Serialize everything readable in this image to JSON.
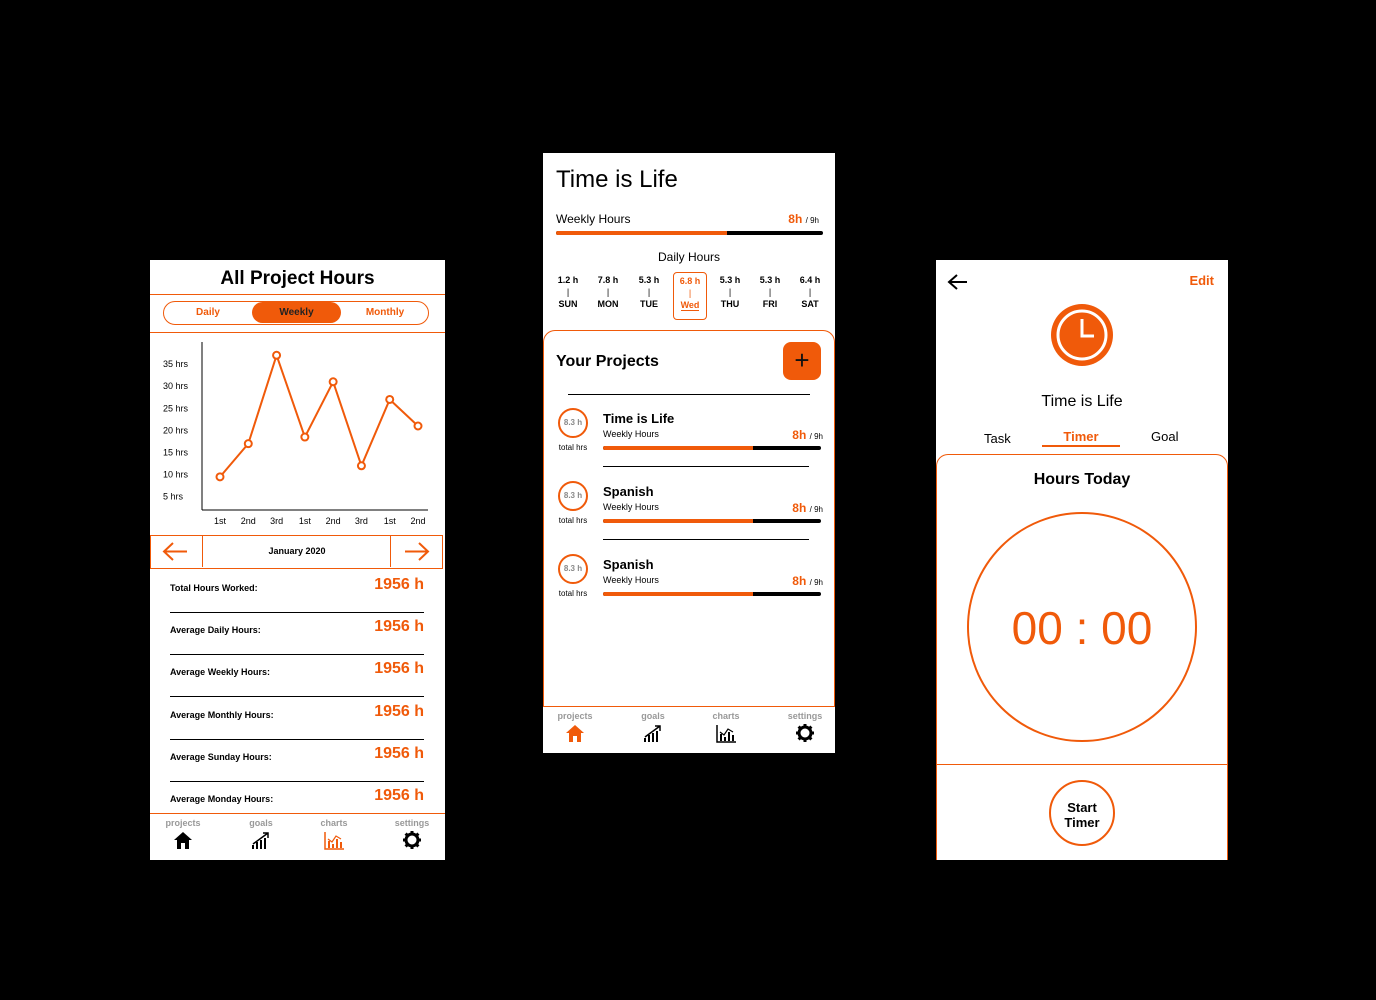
{
  "left": {
    "title": "All Project Hours",
    "tabs": [
      "Daily",
      "Weekly",
      "Monthly"
    ],
    "active_tab": "Weekly",
    "period": "January 2020",
    "stats": [
      {
        "label": "Total Hours Worked:",
        "value": "1956 h"
      },
      {
        "label": "Average Daily Hours:",
        "value": "1956 h"
      },
      {
        "label": "Average Weekly Hours:",
        "value": "1956 h"
      },
      {
        "label": "Average Monthly Hours:",
        "value": "1956 h"
      },
      {
        "label": "Average Sunday Hours:",
        "value": "1956 h"
      },
      {
        "label": "Average Monday Hours:",
        "value": "1956 h"
      }
    ]
  },
  "chart_data": {
    "type": "line",
    "categories": [
      "1st",
      "2nd",
      "3rd",
      "1st",
      "2nd",
      "3rd",
      "1st",
      "2nd"
    ],
    "values": [
      9.5,
      17,
      37,
      18.5,
      31,
      12,
      27,
      21
    ],
    "y_ticks": [
      "5 hrs",
      "10 hrs",
      "15 hrs",
      "20 hrs",
      "25 hrs",
      "30 hrs",
      "35 hrs"
    ],
    "ylim": [
      2,
      40
    ],
    "color": "#f05a0a"
  },
  "middle": {
    "title": "Time is Life",
    "weekly_label": "Weekly Hours",
    "weekly_value": "8h",
    "weekly_goal": "/ 9h",
    "weekly_progress": 0.64,
    "daily_label": "Daily Hours",
    "days": [
      {
        "hours": "1.2 h",
        "day": "SUN"
      },
      {
        "hours": "7.8 h",
        "day": "MON"
      },
      {
        "hours": "5.3 h",
        "day": "TUE"
      },
      {
        "hours": "6.8 h",
        "day": "Wed",
        "active": true
      },
      {
        "hours": "5.3 h",
        "day": "THU"
      },
      {
        "hours": "5.3 h",
        "day": "FRI"
      },
      {
        "hours": "6.4 h",
        "day": "SAT"
      }
    ],
    "projects_heading": "Your Projects",
    "add_symbol": "+",
    "projects": [
      {
        "name": "Time is Life",
        "sub": "Weekly Hours",
        "total": "8.3 h",
        "total_label": "total hrs",
        "value": "8h",
        "goal": "/ 9h",
        "progress": 0.69
      },
      {
        "name": "Spanish",
        "sub": "Weekly Hours",
        "total": "8.3 h",
        "total_label": "total hrs",
        "value": "8h",
        "goal": "/ 9h",
        "progress": 0.69
      },
      {
        "name": "Spanish",
        "sub": "Weekly Hours",
        "total": "8.3 h",
        "total_label": "total hrs",
        "value": "8h",
        "goal": "/ 9h",
        "progress": 0.69
      }
    ]
  },
  "nav": {
    "items": [
      "projects",
      "goals",
      "charts",
      "settings"
    ]
  },
  "right": {
    "edit": "Edit",
    "project_name": "Time is Life",
    "tabs": [
      "Task",
      "Timer",
      "Goal"
    ],
    "active_tab": "Timer",
    "hours_today_label": "Hours Today",
    "timer": "00 : 00",
    "start_button": "Start\nTimer"
  },
  "colors": {
    "accent": "#f05a0a",
    "background": "#000000"
  }
}
